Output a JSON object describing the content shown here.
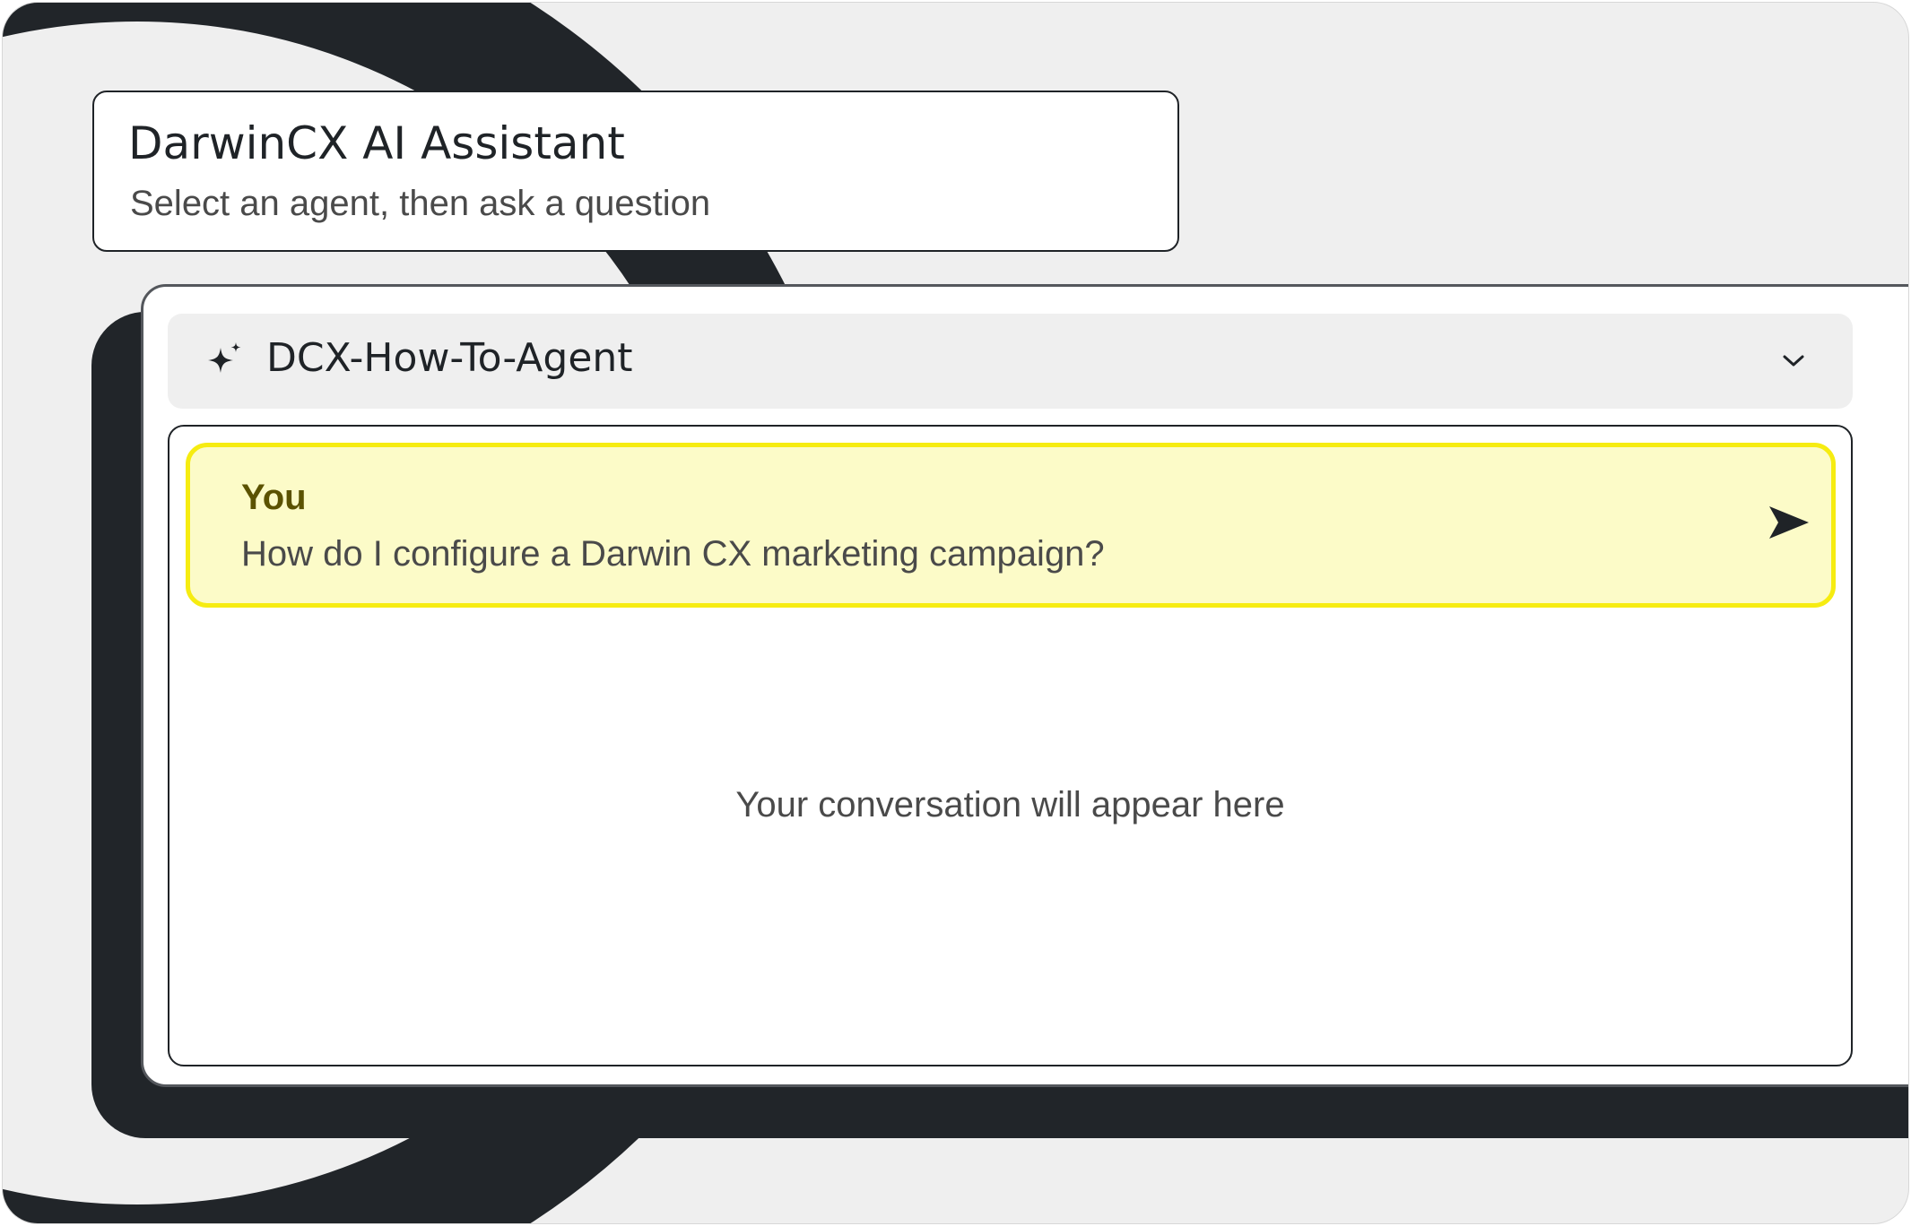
{
  "header": {
    "title": "DarwinCX AI Assistant",
    "subtitle": "Select an agent, then ask a question"
  },
  "agent_selector": {
    "selected_value": "DCX-How-To-Agent",
    "icon": "sparkle-icon",
    "dropdown_icon": "chevron-down-icon"
  },
  "conversation": {
    "messages": [
      {
        "author": "You",
        "text": "How do I configure a Darwin CX marketing campaign?"
      }
    ],
    "empty_state": "Your conversation will appear here",
    "send_icon": "send-icon"
  },
  "colors": {
    "dark": "#212529",
    "highlight_border": "#f6ec11",
    "highlight_fill": "#fcfbc8",
    "author_text": "#5b5200"
  }
}
